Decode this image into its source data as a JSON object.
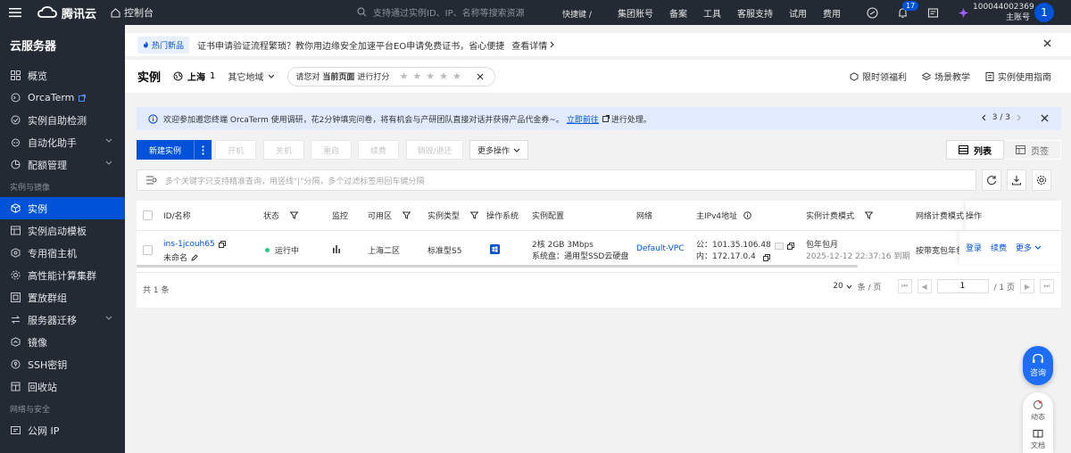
{
  "topbar": {
    "brand": "腾讯云",
    "console": "控制台",
    "search_placeholder": "支持通过实例ID、IP、名称等搜索资源",
    "shortcut": "快捷键 /",
    "links": [
      "集团账号",
      "备案",
      "工具",
      "客服支持",
      "试用",
      "费用"
    ],
    "notif_count": "17",
    "account_id": "100044002369",
    "account_role": "主账号",
    "avatar": "1"
  },
  "sidebar": {
    "title": "云服务器",
    "items_top": [
      {
        "label": "概览",
        "icon": "grid-icon"
      },
      {
        "label": "OrcaTerm",
        "icon": "terminal-icon",
        "external": true
      },
      {
        "label": "实例自助检测",
        "icon": "check-circle-icon"
      },
      {
        "label": "自动化助手",
        "icon": "robot-icon",
        "expand": true
      },
      {
        "label": "配额管理",
        "icon": "pie-icon",
        "expand": true
      }
    ],
    "group1": "实例与镜像",
    "items_mid": [
      {
        "label": "实例",
        "icon": "cube-icon",
        "active": true
      },
      {
        "label": "实例启动模板",
        "icon": "template-icon"
      },
      {
        "label": "专用宿主机",
        "icon": "host-icon"
      },
      {
        "label": "高性能计算集群",
        "icon": "cluster-icon"
      },
      {
        "label": "置放群组",
        "icon": "group-icon"
      },
      {
        "label": "服务器迁移",
        "icon": "migrate-icon",
        "expand": true
      },
      {
        "label": "镜像",
        "icon": "image-icon"
      },
      {
        "label": "SSH密钥",
        "icon": "key-icon"
      },
      {
        "label": "回收站",
        "icon": "recycle-icon"
      }
    ],
    "group2": "网络与安全",
    "items_bottom": [
      {
        "label": "公网 IP",
        "icon": "ip-icon"
      }
    ]
  },
  "notice": {
    "tag": "热门新品",
    "text": "证书申请验证流程繁琐？教你用边缘安全加速平台EO申请免费证书，省心便捷",
    "link": "查看详情"
  },
  "header": {
    "title": "实例",
    "region": "上海",
    "region_count": "1",
    "other_regions": "其它地域",
    "rate_prefix": "请您对",
    "rate_target": "当前页面",
    "rate_suffix": "进行打分",
    "stars": [
      "★",
      "★",
      "★",
      "★",
      "★"
    ],
    "right_links": [
      "限时领福利",
      "场景教学",
      "实例使用指南"
    ]
  },
  "banner": {
    "text": "欢迎参加邀您终端 OrcaTerm 使用调研，花2分钟填完问卷，将有机会与产研团队直接对话并获得产品代金券~。",
    "link": "立即前往",
    "link_suffix": "进行处理。",
    "pager": "3 / 3"
  },
  "toolbar": {
    "new_instance": "新建实例",
    "start": "开机",
    "shutdown": "关机",
    "restart": "重启",
    "renew": "续费",
    "destroy": "销毁/退还",
    "more_actions": "更多操作",
    "view_list": "列表",
    "view_page": "页签"
  },
  "search": {
    "placeholder": "多个关键字只支持精准查询，用竖线\"|\"分隔，多个过滤标签用回车键分隔"
  },
  "table": {
    "headers": [
      "ID/名称",
      "状态",
      "监控",
      "可用区",
      "实例类型",
      "操作系统",
      "实例配置",
      "网络",
      "主IPv4地址",
      "实例计费模式",
      "网络计费模式",
      "操作"
    ],
    "row": {
      "id": "ins-1jcouh65",
      "name": "未命名",
      "status": "运行中",
      "zone": "上海二区",
      "type": "标准型S5",
      "config_line1": "2核 2GB 3Mbps",
      "config_line2": "系统盘：通用型SSD云硬盘",
      "network": "Default-VPC",
      "public_ip": "公：101.35.106.48",
      "private_ip": "内：172.17.0.4",
      "billing": "包年包月",
      "expire": "2025-12-12 22:37:16 到期",
      "net_billing": "按带宽包年包",
      "ops": [
        "登录",
        "续费",
        "更多"
      ]
    },
    "total": "共 1 条",
    "page_size": "20",
    "page_size_unit": "条 / 页",
    "page": "1",
    "page_total": "/ 1 页"
  },
  "float": {
    "consult": "咨询",
    "dynamic": "动态",
    "docs": "文档"
  },
  "colors": {
    "brand": "#0052d9",
    "topbar": "#232a33",
    "running": "#29cc85"
  }
}
